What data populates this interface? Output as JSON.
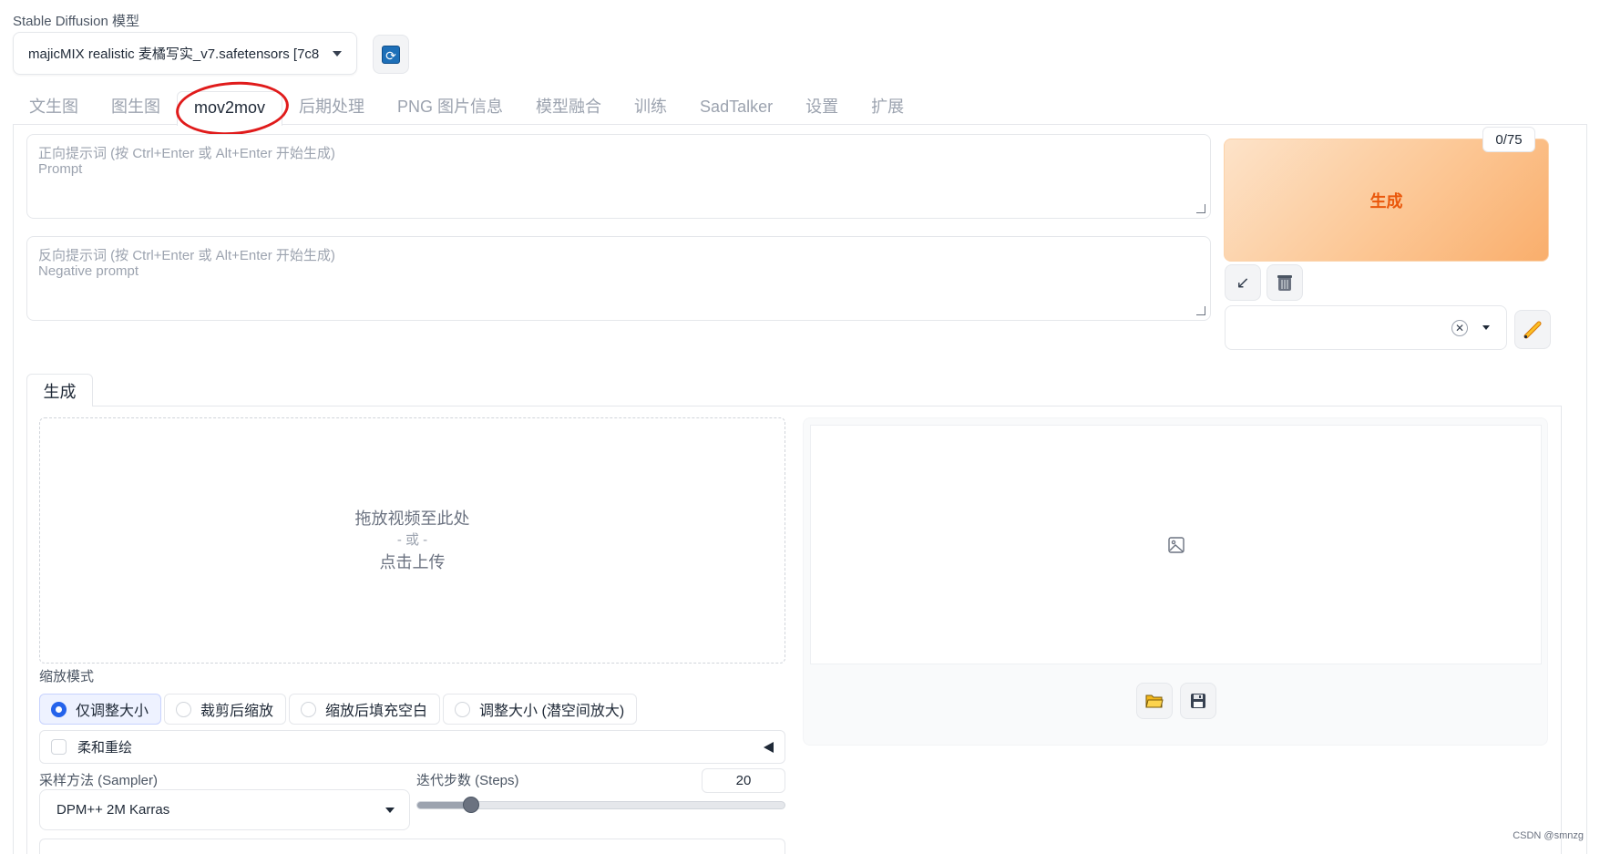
{
  "model": {
    "label": "Stable Diffusion 模型",
    "selected": "majicMIX realistic 麦橘写实_v7.safetensors [7c8"
  },
  "tabs": [
    {
      "label": "文生图",
      "active": false
    },
    {
      "label": "图生图",
      "active": false
    },
    {
      "label": "mov2mov",
      "active": true
    },
    {
      "label": "后期处理",
      "active": false
    },
    {
      "label": "PNG 图片信息",
      "active": false
    },
    {
      "label": "模型融合",
      "active": false
    },
    {
      "label": "训练",
      "active": false
    },
    {
      "label": "SadTalker",
      "active": false
    },
    {
      "label": "设置",
      "active": false
    },
    {
      "label": "扩展",
      "active": false
    }
  ],
  "prompt": {
    "placeholder_line1": "正向提示词 (按 Ctrl+Enter 或 Alt+Enter 开始生成)",
    "placeholder_line2": "Prompt"
  },
  "negative_prompt": {
    "placeholder_line1": "反向提示词 (按 Ctrl+Enter 或 Alt+Enter 开始生成)",
    "placeholder_line2": "Negative prompt"
  },
  "token_counter": "0/75",
  "generate_label": "生成",
  "inner_tab_label": "生成",
  "video_upload": {
    "line1": "拖放视频至此处",
    "line2": "- 或 -",
    "line3": "点击上传"
  },
  "resize_mode": {
    "label": "缩放模式",
    "options": [
      "仅调整大小",
      "裁剪后缩放",
      "缩放后填充空白",
      "调整大小 (潜空间放大)"
    ],
    "selected_index": 0
  },
  "soft_inpainting_label": "柔和重绘",
  "sampler": {
    "label": "采样方法 (Sampler)",
    "value": "DPM++ 2M Karras"
  },
  "steps": {
    "label": "迭代步数 (Steps)",
    "value": "20",
    "min": 1,
    "max": 150,
    "current": 20
  },
  "icons": {
    "refresh": "refresh-icon",
    "arrow": "arrow-down-left-icon",
    "trash": "trash-icon",
    "pencil": "pencil-icon",
    "image_placeholder": "image-icon",
    "folder": "folder-icon",
    "save": "save-icon"
  },
  "colors": {
    "accent": "#ea580c",
    "radio_selected": "#2563eb",
    "annotation": "#e01b1b"
  },
  "watermark": "CSDN @smnzg"
}
